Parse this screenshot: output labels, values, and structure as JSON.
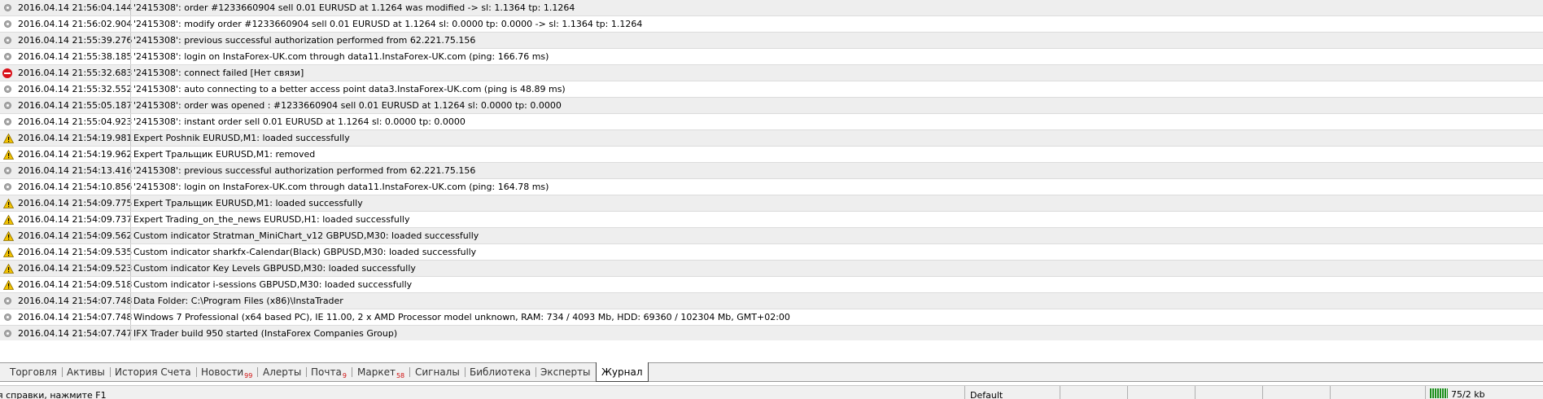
{
  "journal": {
    "rows": [
      {
        "icon": "info",
        "time": "2016.04.14 21:56:04.144",
        "message": "'2415308': order #1233660904 sell 0.01 EURUSD at 1.1264 was modified -> sl: 1.1364 tp: 1.1264"
      },
      {
        "icon": "info",
        "time": "2016.04.14 21:56:02.904",
        "message": "'2415308': modify order #1233660904 sell 0.01 EURUSD at 1.1264 sl: 0.0000 tp: 0.0000 -> sl: 1.1364 tp: 1.1264"
      },
      {
        "icon": "info",
        "time": "2016.04.14 21:55:39.276",
        "message": "'2415308': previous successful authorization performed from 62.221.75.156"
      },
      {
        "icon": "info",
        "time": "2016.04.14 21:55:38.185",
        "message": "'2415308': login on InstaForex-UK.com through data11.InstaForex-UK.com (ping: 166.76 ms)"
      },
      {
        "icon": "error",
        "time": "2016.04.14 21:55:32.683",
        "message": "'2415308': connect failed [Нет связи]"
      },
      {
        "icon": "info",
        "time": "2016.04.14 21:55:32.552",
        "message": "'2415308': auto connecting to a better access point data3.InstaForex-UK.com (ping is 48.89 ms)"
      },
      {
        "icon": "info",
        "time": "2016.04.14 21:55:05.187",
        "message": "'2415308': order was opened : #1233660904 sell 0.01 EURUSD at 1.1264 sl: 0.0000 tp: 0.0000"
      },
      {
        "icon": "info",
        "time": "2016.04.14 21:55:04.923",
        "message": "'2415308': instant order sell 0.01 EURUSD at 1.1264 sl: 0.0000 tp: 0.0000"
      },
      {
        "icon": "warning",
        "time": "2016.04.14 21:54:19.981",
        "message": "Expert Poshnik EURUSD,M1: loaded successfully"
      },
      {
        "icon": "warning",
        "time": "2016.04.14 21:54:19.962",
        "message": "Expert Тральщик EURUSD,M1: removed"
      },
      {
        "icon": "info",
        "time": "2016.04.14 21:54:13.416",
        "message": "'2415308': previous successful authorization performed from 62.221.75.156"
      },
      {
        "icon": "info",
        "time": "2016.04.14 21:54:10.856",
        "message": "'2415308': login on InstaForex-UK.com through data11.InstaForex-UK.com (ping: 164.78 ms)"
      },
      {
        "icon": "warning",
        "time": "2016.04.14 21:54:09.775",
        "message": "Expert Тральщик EURUSD,M1: loaded successfully"
      },
      {
        "icon": "warning",
        "time": "2016.04.14 21:54:09.737",
        "message": "Expert Trading_on_the_news EURUSD,H1: loaded successfully"
      },
      {
        "icon": "warning",
        "time": "2016.04.14 21:54:09.562",
        "message": "Custom indicator Stratman_MiniChart_v12 GBPUSD,M30: loaded successfully"
      },
      {
        "icon": "warning",
        "time": "2016.04.14 21:54:09.535",
        "message": "Custom indicator sharkfx-Calendar(Black) GBPUSD,M30: loaded successfully"
      },
      {
        "icon": "warning",
        "time": "2016.04.14 21:54:09.523",
        "message": "Custom indicator Key Levels GBPUSD,M30: loaded successfully"
      },
      {
        "icon": "warning",
        "time": "2016.04.14 21:54:09.518",
        "message": "Custom indicator i-sessions GBPUSD,M30: loaded successfully"
      },
      {
        "icon": "info",
        "time": "2016.04.14 21:54:07.748",
        "message": "Data Folder: C:\\Program Files (x86)\\InstaTrader"
      },
      {
        "icon": "info",
        "time": "2016.04.14 21:54:07.748",
        "message": "Windows 7 Professional (x64 based PC), IE 11.00, 2 x AMD Processor model unknown, RAM: 734 / 4093 Mb, HDD: 69360 / 102304 Mb, GMT+02:00"
      },
      {
        "icon": "info",
        "time": "2016.04.14 21:54:07.747",
        "message": "IFX Trader build 950 started (InstaForex Companies Group)"
      }
    ]
  },
  "tabs": [
    {
      "label": "Торговля",
      "count": ""
    },
    {
      "label": "Активы",
      "count": ""
    },
    {
      "label": "История Счета",
      "count": ""
    },
    {
      "label": "Новости",
      "count": "99"
    },
    {
      "label": "Алерты",
      "count": ""
    },
    {
      "label": "Почта",
      "count": "9"
    },
    {
      "label": "Маркет",
      "count": "58"
    },
    {
      "label": "Сигналы",
      "count": ""
    },
    {
      "label": "Библиотека",
      "count": ""
    },
    {
      "label": "Эксперты",
      "count": ""
    },
    {
      "label": "Журнал",
      "count": "",
      "active": true
    }
  ],
  "status": {
    "hint": "я справки, нажмите F1",
    "profile": "Default",
    "traffic": "75/2 kb"
  },
  "colors": {
    "error": "#d9121b",
    "warning": "#f2c200",
    "info": "#a9a9a9",
    "badge": "#d01010"
  }
}
